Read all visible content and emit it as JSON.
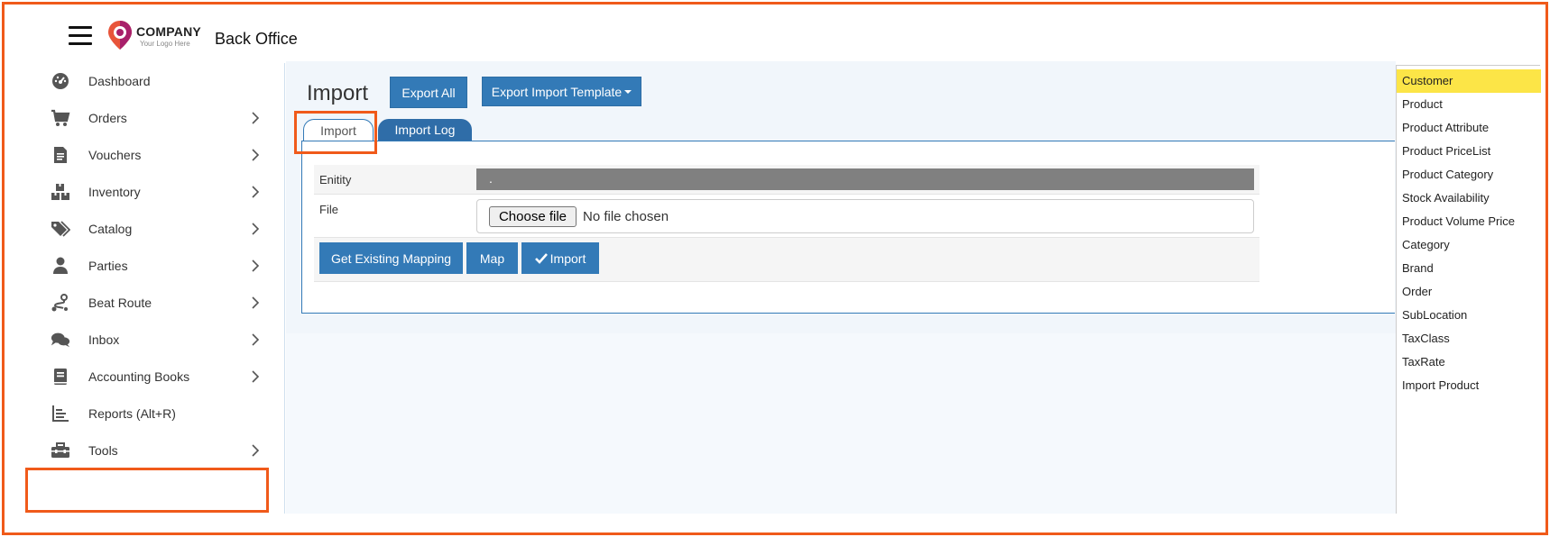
{
  "header": {
    "company_name": "COMPANY",
    "company_sub": "Your Logo Here",
    "app_title": "Back Office"
  },
  "sidebar": {
    "items": [
      {
        "label": "Dashboard",
        "icon": "dashboard-icon",
        "has_chevron": false
      },
      {
        "label": "Orders",
        "icon": "cart-icon",
        "has_chevron": true
      },
      {
        "label": "Vouchers",
        "icon": "document-icon",
        "has_chevron": true
      },
      {
        "label": "Inventory",
        "icon": "boxes-icon",
        "has_chevron": true
      },
      {
        "label": "Catalog",
        "icon": "tags-icon",
        "has_chevron": true
      },
      {
        "label": "Parties",
        "icon": "person-icon",
        "has_chevron": true
      },
      {
        "label": "Beat Route",
        "icon": "route-icon",
        "has_chevron": true
      },
      {
        "label": "Inbox",
        "icon": "chat-icon",
        "has_chevron": true
      },
      {
        "label": "Accounting Books",
        "icon": "book-icon",
        "has_chevron": true
      },
      {
        "label": "Reports (Alt+R)",
        "icon": "bar-chart-icon",
        "has_chevron": false
      },
      {
        "label": "Tools",
        "icon": "toolbox-icon",
        "has_chevron": true
      }
    ]
  },
  "main": {
    "title": "Import",
    "export_all_label": "Export All",
    "export_template_label": "Export Import Template",
    "tabs": [
      {
        "label": "Import",
        "active": true
      },
      {
        "label": "Import Log",
        "active": false
      }
    ],
    "form": {
      "entity_label": "Enitity",
      "entity_value": ".",
      "file_label": "File",
      "choose_file_label": "Choose file",
      "no_file_text": "No file chosen",
      "get_mapping_label": "Get Existing Mapping",
      "map_label": "Map",
      "import_label": "Import"
    }
  },
  "dropdown": {
    "options": [
      "Customer",
      "Product",
      "Product Attribute",
      "Product PriceList",
      "Product Category",
      "Stock Availability",
      "Product Volume Price",
      "Category",
      "Brand",
      "Order",
      "SubLocation",
      "TaxClass",
      "TaxRate",
      "Import Product"
    ],
    "selected": "Customer"
  },
  "colors": {
    "primary": "#337ab7",
    "highlight": "#f05a1a",
    "selected_option": "#fce547"
  }
}
